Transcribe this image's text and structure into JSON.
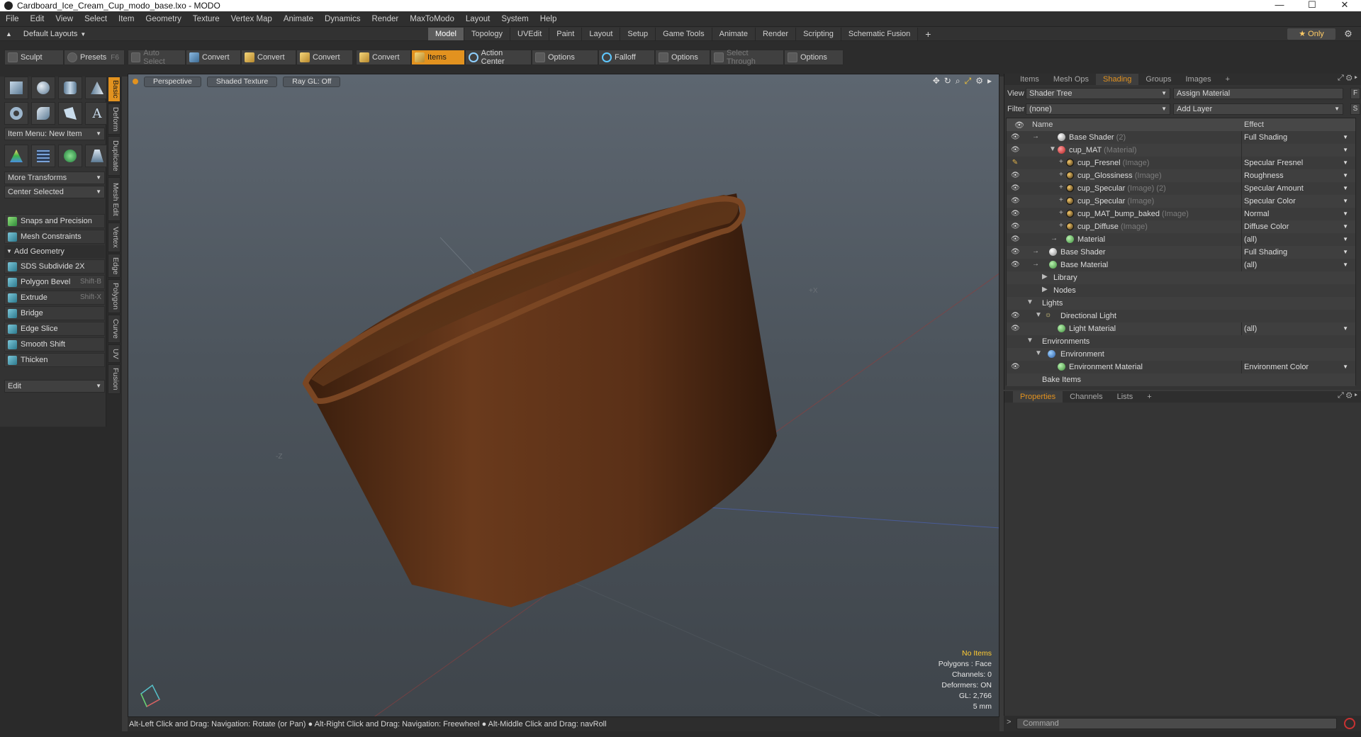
{
  "window": {
    "title": "Cardboard_Ice_Cream_Cup_modo_base.lxo - MODO",
    "controls": [
      "—",
      "☐",
      "✕"
    ]
  },
  "menu": [
    "File",
    "Edit",
    "View",
    "Select",
    "Item",
    "Geometry",
    "Texture",
    "Vertex Map",
    "Animate",
    "Dynamics",
    "Render",
    "MaxToModo",
    "Layout",
    "System",
    "Help"
  ],
  "layout_bar": {
    "layout_select": "Default Layouts",
    "tabs": [
      "Model",
      "Topology",
      "UVEdit",
      "Paint",
      "Layout",
      "Setup",
      "Game Tools",
      "Animate",
      "Render",
      "Scripting",
      "Schematic Fusion"
    ],
    "active_tab": "Model",
    "only_label": "Only"
  },
  "toolbar": {
    "sculpt": "Sculpt",
    "presets": "Presets",
    "presets_key": "F6",
    "auto_select": "Auto Select",
    "convert1": "Convert",
    "convert2": "Convert",
    "convert3": "Convert",
    "convert4": "Convert",
    "items": "Items",
    "action_center": "Action Center",
    "options1": "Options",
    "falloff": "Falloff",
    "options2": "Options",
    "select_through": "Select Through",
    "options3": "Options"
  },
  "toolbox": {
    "item_menu": "Item Menu: New Item",
    "more_transforms": "More Transforms",
    "center_selected": "Center Selected",
    "snaps": "Snaps and Precision",
    "mesh_constraints": "Mesh Constraints",
    "add_geometry": "Add Geometry",
    "tools": [
      {
        "label": "SDS Subdivide 2X",
        "key": ""
      },
      {
        "label": "Polygon Bevel",
        "key": "Shift-B"
      },
      {
        "label": "Extrude",
        "key": "Shift-X"
      },
      {
        "label": "Bridge",
        "key": ""
      },
      {
        "label": "Edge Slice",
        "key": ""
      },
      {
        "label": "Smooth Shift",
        "key": ""
      },
      {
        "label": "Thicken",
        "key": ""
      }
    ],
    "edit_dd": "Edit"
  },
  "vtabs": [
    "Basic",
    "Deform",
    "Duplicate",
    "Mesh Edit",
    "Vertex",
    "Edge",
    "Polygon",
    "Curve",
    "UV",
    "Fusion"
  ],
  "viewport": {
    "perspective": "Perspective",
    "shading": "Shaded Texture",
    "raygl": "Ray GL: Off",
    "info": {
      "items": "No Items",
      "polygons": "Polygons : Face",
      "channels": "Channels: 0",
      "deformers": "Deformers: ON",
      "gl": "GL: 2,766",
      "scale": "5 mm"
    },
    "axis_x": "+X",
    "axis_z": "-Z"
  },
  "statusbar": "Alt-Left Click and Drag: Navigation: Rotate (or Pan) ● Alt-Right Click and Drag: Navigation: Freewheel ● Alt-Middle Click and Drag: navRoll",
  "shader_panel": {
    "tabs": [
      "Items",
      "Mesh Ops",
      "Shading",
      "Groups",
      "Images"
    ],
    "active_tab": "Shading",
    "view_label": "View",
    "view_value": "Shader Tree",
    "assign_material": "Assign Material",
    "filter_label": "Filter",
    "filter_value": "(none)",
    "add_layer": "Add Layer",
    "col_name": "Name",
    "col_effect": "Effect",
    "rows": [
      {
        "name": "Base Shader",
        "sub": "(2)",
        "effect": "Full Shading"
      },
      {
        "name": "cup_MAT",
        "sub": "(Material)",
        "effect": ""
      },
      {
        "name": "cup_Fresnel",
        "sub": "(Image)",
        "effect": "Specular Fresnel"
      },
      {
        "name": "cup_Glossiness",
        "sub": "(Image)",
        "effect": "Roughness"
      },
      {
        "name": "cup_Specular",
        "sub": "(Image) (2)",
        "effect": "Specular Amount"
      },
      {
        "name": "cup_Specular",
        "sub": "(Image)",
        "effect": "Specular Color"
      },
      {
        "name": "cup_MAT_bump_baked",
        "sub": "(Image)",
        "effect": "Normal"
      },
      {
        "name": "cup_Diffuse",
        "sub": "(Image)",
        "effect": "Diffuse Color"
      },
      {
        "name": "Material",
        "sub": "",
        "effect": "(all)"
      },
      {
        "name": "Base Shader",
        "sub": "",
        "effect": "Full Shading"
      },
      {
        "name": "Base Material",
        "sub": "",
        "effect": "(all)"
      },
      {
        "name": "Library",
        "sub": "",
        "effect": ""
      },
      {
        "name": "Nodes",
        "sub": "",
        "effect": ""
      },
      {
        "name": "Lights",
        "sub": "",
        "effect": ""
      },
      {
        "name": "Directional Light",
        "sub": "",
        "effect": ""
      },
      {
        "name": "Light Material",
        "sub": "",
        "effect": "(all)"
      },
      {
        "name": "Environments",
        "sub": "",
        "effect": ""
      },
      {
        "name": "Environment",
        "sub": "",
        "effect": ""
      },
      {
        "name": "Environment Material",
        "sub": "",
        "effect": "Environment Color"
      },
      {
        "name": "Bake Items",
        "sub": "",
        "effect": ""
      }
    ]
  },
  "properties_panel": {
    "tabs": [
      "Properties",
      "Channels",
      "Lists"
    ],
    "active_tab": "Properties"
  },
  "command": {
    "placeholder": "Command"
  }
}
